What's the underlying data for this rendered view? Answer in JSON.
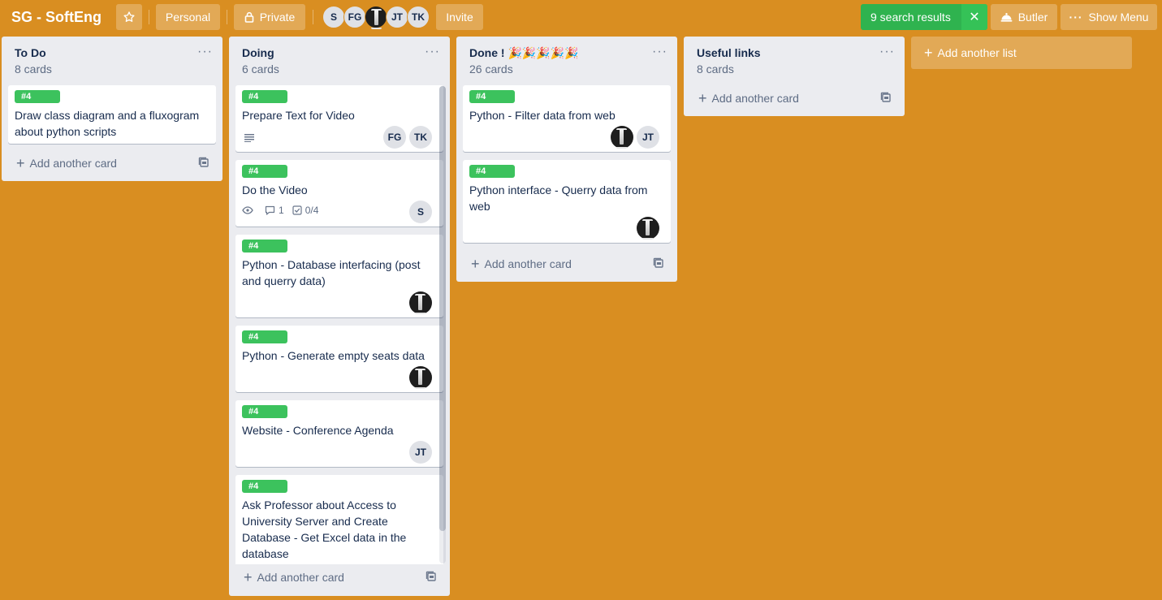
{
  "header": {
    "board_title": "SG - SoftEng",
    "personal_label": "Personal",
    "private_label": "Private",
    "members": [
      "S",
      "FG",
      "",
      "JT",
      "TK"
    ],
    "invite_label": "Invite",
    "search_results_label": "9 search results",
    "butler_label": "Butler",
    "show_menu_label": "Show Menu"
  },
  "lists": [
    {
      "title": "To Do",
      "count": "8 cards",
      "add_card_label": "Add another card",
      "cards": [
        {
          "label": "#4",
          "title": "Draw class diagram and a fluxogram about python scripts"
        }
      ]
    },
    {
      "title": "Doing",
      "count": "6 cards",
      "add_card_label": "Add another card",
      "cards": [
        {
          "label": "#4",
          "title": "Prepare Text for Video",
          "members": [
            "FG",
            "TK"
          ]
        },
        {
          "label": "#4",
          "title": "Do the Video",
          "comments": "1",
          "checklist": "0/4",
          "members": [
            "S"
          ]
        },
        {
          "label": "#4",
          "title": "Python - Database interfacing (post and querry data)"
        },
        {
          "label": "#4",
          "title": "Python - Generate empty seats data"
        },
        {
          "label": "#4",
          "title": "Website - Conference Agenda",
          "members": [
            "JT"
          ]
        },
        {
          "label": "#4",
          "title": "Ask Professor about Access to University Server and Create Database - Get Excel data in the database"
        }
      ]
    },
    {
      "title": "Done ! 🎉🎉🎉🎉🎉",
      "count": "26 cards",
      "add_card_label": "Add another card",
      "cards": [
        {
          "label": "#4",
          "title": "Python - Filter data from web",
          "members": [
            "",
            "JT"
          ]
        },
        {
          "label": "#4",
          "title": "Python interface - Querry data from web"
        }
      ]
    },
    {
      "title": "Useful links",
      "count": "8 cards",
      "add_card_label": "Add another card",
      "cards": []
    }
  ],
  "add_list_label": "Add another list",
  "colors": {
    "board_background": "#d98e21",
    "label_green": "#3cc25d",
    "list_background": "#ebecf0",
    "search_green": "#2fb34f"
  }
}
